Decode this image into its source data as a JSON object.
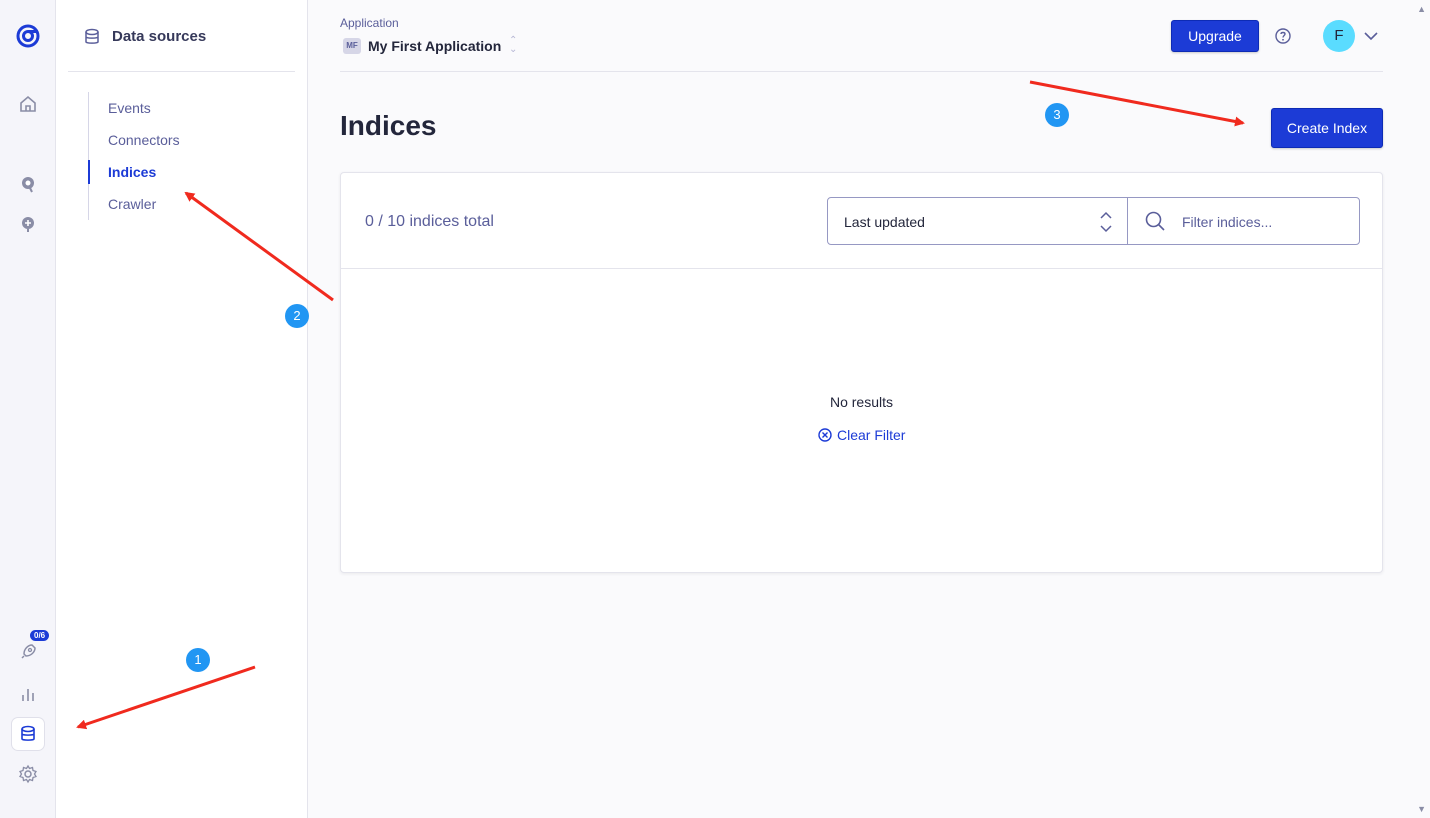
{
  "rail": {
    "items": [
      {
        "icon": "algolia-logo-icon"
      },
      {
        "icon": "home-icon"
      },
      {
        "icon": "search-icon"
      },
      {
        "icon": "recommend-icon"
      },
      {
        "icon": "rocket-icon",
        "badge": "0/6"
      },
      {
        "icon": "analytics-icon"
      },
      {
        "icon": "database-icon",
        "active": true
      },
      {
        "icon": "gear-icon"
      }
    ]
  },
  "sidebar": {
    "title": "Data sources",
    "items": [
      {
        "label": "Events"
      },
      {
        "label": "Connectors"
      },
      {
        "label": "Indices",
        "active": true
      },
      {
        "label": "Crawler"
      }
    ]
  },
  "header": {
    "app_label": "Application",
    "app_badge": "MF",
    "app_name": "My First Application",
    "upgrade_label": "Upgrade",
    "avatar_initial": "F"
  },
  "page": {
    "title": "Indices",
    "create_label": "Create Index"
  },
  "card": {
    "count_text": "0 / 10 indices total",
    "sort_value": "Last updated",
    "filter_placeholder": "Filter indices...",
    "empty_text": "No results",
    "clear_label": "Clear Filter"
  },
  "annotations": {
    "steps": [
      "1",
      "2",
      "3"
    ],
    "arrow_color": "#f02a1e",
    "step_color": "#2196f3"
  },
  "colors": {
    "accent": "#1c3bd6",
    "avatar": "#5adcff"
  }
}
